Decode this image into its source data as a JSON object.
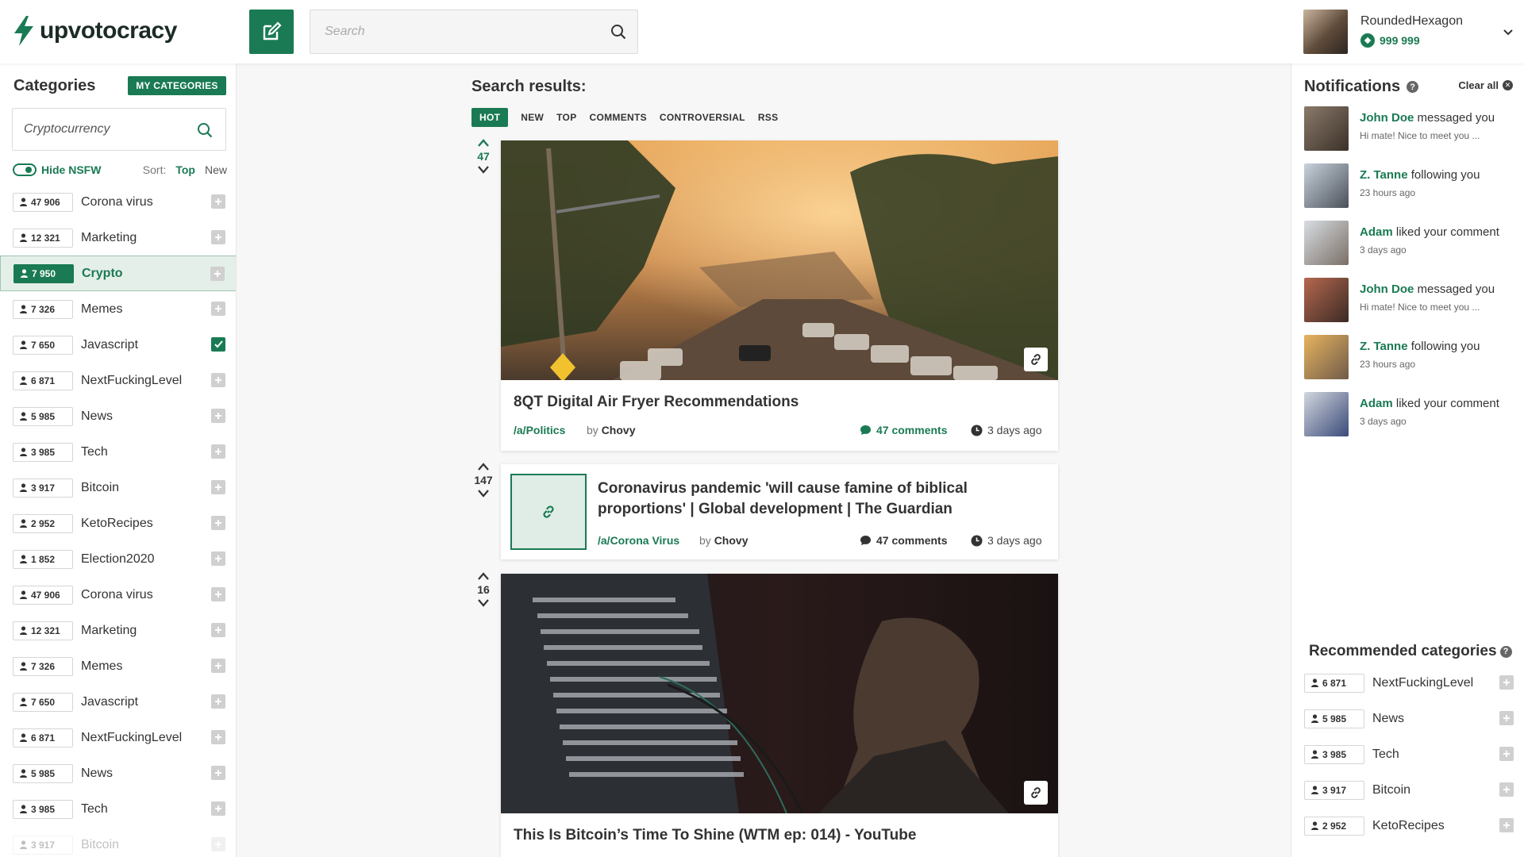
{
  "header": {
    "logo_text": "upvotocracy",
    "search_placeholder": "Search",
    "user": {
      "name": "RoundedHexagon",
      "coins": "999 999"
    }
  },
  "categories": {
    "title": "Categories",
    "my_categories_label": "MY CATEGORIES",
    "search_value": "Cryptocurrency",
    "hide_nsfw_label": "Hide NSFW",
    "sort_label": "Sort:",
    "sort_top": "Top",
    "sort_new": "New",
    "items": [
      {
        "count": "47 906",
        "name": "Corona virus",
        "state": "add"
      },
      {
        "count": "12 321",
        "name": "Marketing",
        "state": "add"
      },
      {
        "count": "7 950",
        "name": "Crypto",
        "state": "active"
      },
      {
        "count": "7 326",
        "name": "Memes",
        "state": "add"
      },
      {
        "count": "7 650",
        "name": "Javascript",
        "state": "checked"
      },
      {
        "count": "6 871",
        "name": "NextFuckingLevel",
        "state": "add"
      },
      {
        "count": "5 985",
        "name": "News",
        "state": "add"
      },
      {
        "count": "3 985",
        "name": "Tech",
        "state": "add"
      },
      {
        "count": "3 917",
        "name": "Bitcoin",
        "state": "add"
      },
      {
        "count": "2 952",
        "name": "KetoRecipes",
        "state": "add"
      },
      {
        "count": "1 852",
        "name": "Election2020",
        "state": "add"
      },
      {
        "count": "47 906",
        "name": "Corona virus",
        "state": "add"
      },
      {
        "count": "12 321",
        "name": "Marketing",
        "state": "add"
      },
      {
        "count": "7 326",
        "name": "Memes",
        "state": "add"
      },
      {
        "count": "7 650",
        "name": "Javascript",
        "state": "add"
      },
      {
        "count": "6 871",
        "name": "NextFuckingLevel",
        "state": "add"
      },
      {
        "count": "5 985",
        "name": "News",
        "state": "add"
      },
      {
        "count": "3 985",
        "name": "Tech",
        "state": "add"
      },
      {
        "count": "3 917",
        "name": "Bitcoin",
        "state": "faded"
      }
    ]
  },
  "feed": {
    "title": "Search results:",
    "tabs": [
      "HOT",
      "NEW",
      "TOP",
      "COMMENTS",
      "CONTROVERSIAL",
      "RSS"
    ],
    "posts": [
      {
        "score": "47",
        "title": "8QT Digital Air Fryer Recommendations",
        "category": "/a/Politics",
        "by_label": "by",
        "author": "Chovy",
        "comments": "47 comments",
        "time": "3 days ago"
      },
      {
        "score": "147",
        "title_line1": "Coronavirus pandemic 'will cause famine of biblical",
        "title_line2": "proportions' | Global development | The Guardian",
        "category": "/a/Corona Virus",
        "by_label": "by",
        "author": "Chovy",
        "comments": "47 comments",
        "time": "3 days ago"
      },
      {
        "score": "16",
        "title": "This Is Bitcoin’s Time To Shine (WTM ep: 014) - YouTube"
      }
    ]
  },
  "notifications": {
    "title": "Notifications",
    "clear_all": "Clear all",
    "items": [
      {
        "name": "John Doe",
        "action": "messaged you",
        "sub": "Hi mate! Nice to meet you ..."
      },
      {
        "name": "Z. Tanne",
        "action": "following you",
        "sub": "23 hours ago"
      },
      {
        "name": "Adam",
        "action": "liked your comment",
        "sub": "3 days ago"
      },
      {
        "name": "John Doe",
        "action": "messaged you",
        "sub": "Hi mate! Nice to meet you ..."
      },
      {
        "name": "Z. Tanne",
        "action": "following you",
        "sub": "23 hours ago"
      },
      {
        "name": "Adam",
        "action": "liked your comment",
        "sub": "3 days ago"
      }
    ]
  },
  "recommended": {
    "title": "Recommended categories",
    "items": [
      {
        "count": "6 871",
        "name": "NextFuckingLevel"
      },
      {
        "count": "5 985",
        "name": "News"
      },
      {
        "count": "3 985",
        "name": "Tech"
      },
      {
        "count": "3 917",
        "name": "Bitcoin"
      },
      {
        "count": "2 952",
        "name": "KetoRecipes"
      }
    ]
  },
  "colors": {
    "accent": "#1a7a53",
    "accent_light": "#e5efe9"
  }
}
